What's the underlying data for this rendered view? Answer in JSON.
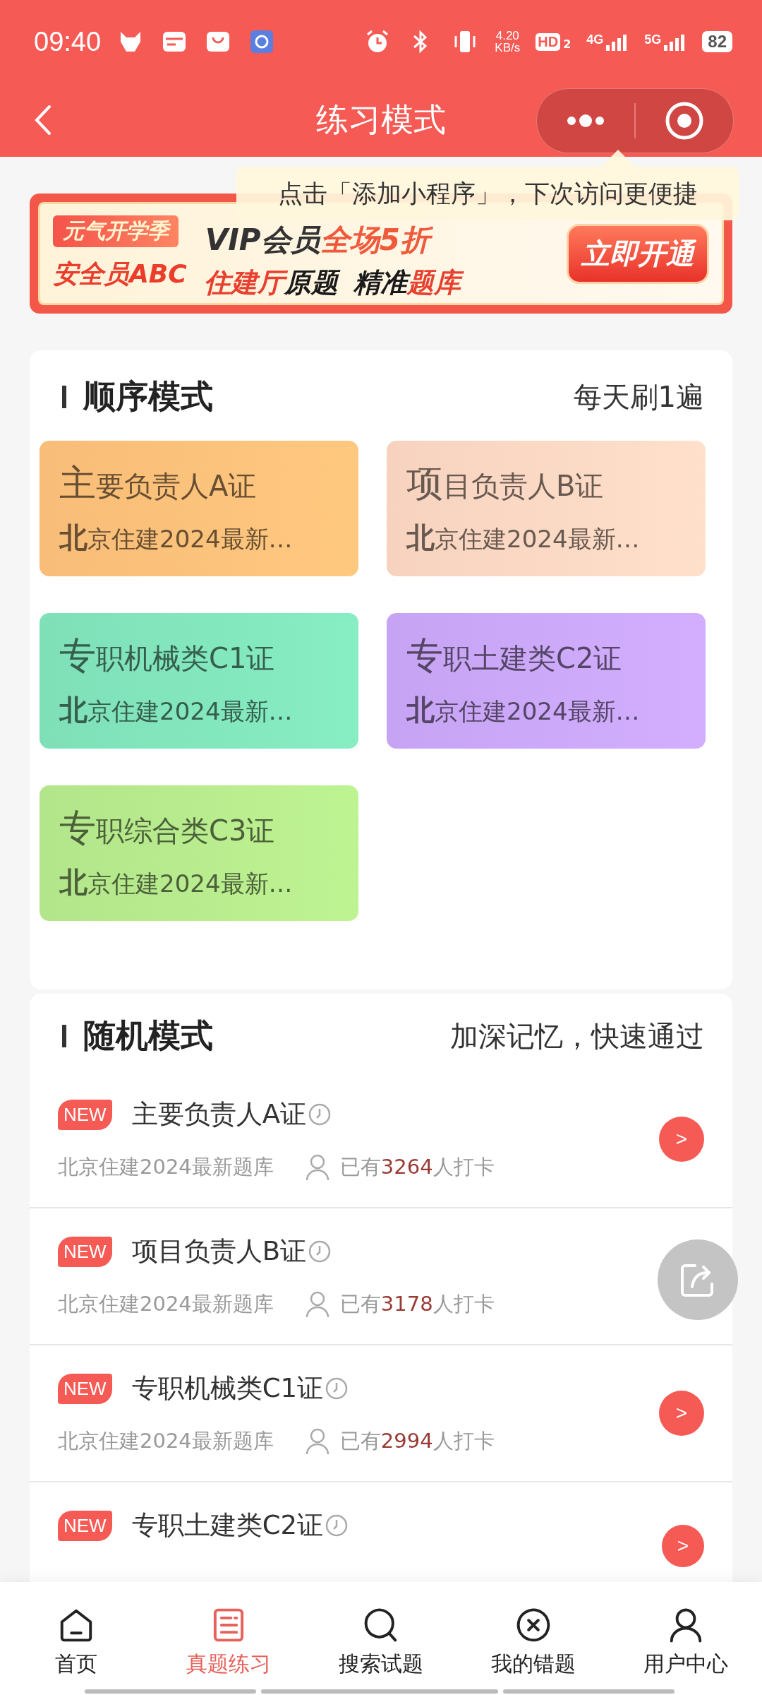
{
  "status_bar": {
    "time": "09:40",
    "net_speed": "4.20",
    "net_unit": "KB/s",
    "hd": "HD",
    "hd_sub": "2",
    "net_1": "4G",
    "net_2": "5G",
    "battery": "82"
  },
  "header": {
    "title": "练习模式"
  },
  "tooltip": {
    "text": "点击「添加小程序」，下次访问更便捷"
  },
  "banner": {
    "tag": "元气开学季",
    "subject": "安全员ABC",
    "headline": "VIP会员",
    "headline_accent": "全场5折",
    "slogan": [
      {
        "text": "住建厅",
        "color": "#e8402f"
      },
      {
        "text": "原题",
        "color": "#1a1a1a"
      },
      {
        "text": "精准",
        "color": "#1a1a1a"
      },
      {
        "text": "题库",
        "color": "#e8402f"
      }
    ],
    "button": "立即开通"
  },
  "sequential": {
    "title": "顺序模式",
    "hint": "每天刷1遍",
    "tiles": [
      {
        "title": "主要负责人A证",
        "subtitle": "北京住建2024最新…",
        "color": "#f8bd78"
      },
      {
        "title": "项目负责人B证",
        "subtitle": "北京住建2024最新…",
        "color": "#f7d3bf"
      },
      {
        "title": "专职机械类C1证",
        "subtitle": "北京住建2024最新…",
        "color": "#7fe0b8"
      },
      {
        "title": "专职土建类C2证",
        "subtitle": "北京住建2024最新…",
        "color": "#c7a4f3"
      },
      {
        "title": "专职综合类C3证",
        "subtitle": "北京住建2024最新…",
        "color": "#b3e58a"
      }
    ]
  },
  "random": {
    "title": "随机模式",
    "hint": "加深记忆，快速通过",
    "items": [
      {
        "badge": "NEW",
        "title": "主要负责人A证",
        "source": "北京住建2024最新题库",
        "count_prefix": "已有",
        "count": "3264",
        "count_suffix": "人打卡",
        "go": ">"
      },
      {
        "badge": "NEW",
        "title": "项目负责人B证",
        "source": "北京住建2024最新题库",
        "count_prefix": "已有",
        "count": "3178",
        "count_suffix": "人打卡"
      },
      {
        "badge": "NEW",
        "title": "专职机械类C1证",
        "source": "北京住建2024最新题库",
        "count_prefix": "已有",
        "count": "2994",
        "count_suffix": "人打卡",
        "go": ">"
      },
      {
        "badge": "NEW",
        "title": "专职土建类C2证",
        "go": ">"
      }
    ]
  },
  "tab_bar": [
    {
      "label": "首页",
      "selected": false
    },
    {
      "label": "真题练习",
      "selected": true
    },
    {
      "label": "搜索试题",
      "selected": false
    },
    {
      "label": "我的错题",
      "selected": false
    },
    {
      "label": "用户中心",
      "selected": false
    }
  ]
}
